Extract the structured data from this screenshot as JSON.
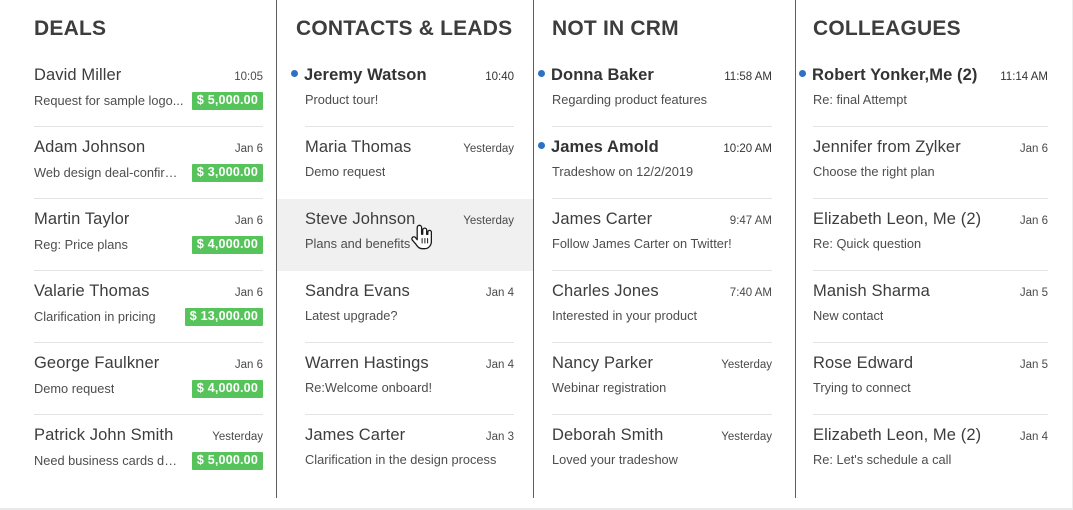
{
  "colors": {
    "accent_green": "#57c45b",
    "unread_dot_blue": "#2f6fc4",
    "divider": "#5d5d5d",
    "row_separator": "#e3e3e3",
    "highlight_bg": "#f0f0f0",
    "text_primary": "#3d3d3d"
  },
  "columns": [
    {
      "title": "DEALS",
      "rows": [
        {
          "name": "David Miller",
          "time": "10:05",
          "snippet": "Request for sample logo...",
          "amount": "$ 5,000.00",
          "unread": false,
          "separator": true,
          "highlight": false
        },
        {
          "name": "Adam Johnson",
          "time": "Jan 6",
          "snippet": "Web design deal-confirm...",
          "amount": "$ 3,000.00",
          "unread": false,
          "separator": true,
          "highlight": false
        },
        {
          "name": "Martin Taylor",
          "time": "Jan 6",
          "snippet": "Reg: Price plans",
          "amount": "$ 4,000.00",
          "unread": false,
          "separator": true,
          "highlight": false
        },
        {
          "name": "Valarie Thomas",
          "time": "Jan 6",
          "snippet": "Clarification in pricing",
          "amount": "$ 13,000.00",
          "unread": false,
          "separator": true,
          "highlight": false
        },
        {
          "name": "George Faulkner",
          "time": "Jan 6",
          "snippet": "Demo request",
          "amount": "$ 4,000.00",
          "unread": false,
          "separator": true,
          "highlight": false
        },
        {
          "name": "Patrick John Smith",
          "time": "Yesterday",
          "snippet": "Need business cards des...",
          "amount": "$ 5,000.00",
          "unread": false,
          "separator": false,
          "highlight": false
        }
      ]
    },
    {
      "title": "CONTACTS & LEADS",
      "rows": [
        {
          "name": "Jeremy Watson",
          "time": "10:40",
          "snippet": "Product tour!",
          "amount": "",
          "unread": true,
          "separator": true,
          "highlight": false
        },
        {
          "name": "Maria Thomas",
          "time": "Yesterday",
          "snippet": "Demo request",
          "amount": "",
          "unread": false,
          "separator": false,
          "highlight": false
        },
        {
          "name": "Steve Johnson",
          "time": "Yesterday",
          "snippet": "Plans and benefits",
          "amount": "",
          "unread": false,
          "separator": false,
          "highlight": true
        },
        {
          "name": "Sandra Evans",
          "time": "Jan 4",
          "snippet": "Latest upgrade?",
          "amount": "",
          "unread": false,
          "separator": true,
          "highlight": false
        },
        {
          "name": "Warren Hastings",
          "time": "Jan 4",
          "snippet": "Re:Welcome onboard!",
          "amount": "",
          "unread": false,
          "separator": true,
          "highlight": false
        },
        {
          "name": "James Carter",
          "time": "Jan 3",
          "snippet": "Clarification in the design process",
          "amount": "",
          "unread": false,
          "separator": false,
          "highlight": false
        }
      ]
    },
    {
      "title": "NOT IN CRM",
      "rows": [
        {
          "name": "Donna Baker",
          "time": "11:58 AM",
          "snippet": "Regarding product features",
          "amount": "",
          "unread": true,
          "separator": true,
          "highlight": false
        },
        {
          "name": "James Amold",
          "time": "10:20 AM",
          "snippet": "Tradeshow on 12/2/2019",
          "amount": "",
          "unread": true,
          "separator": true,
          "highlight": false
        },
        {
          "name": "James Carter",
          "time": "9:47 AM",
          "snippet": "Follow James Carter on Twitter!",
          "amount": "",
          "unread": false,
          "separator": true,
          "highlight": false
        },
        {
          "name": "Charles Jones",
          "time": "7:40 AM",
          "snippet": "Interested in your product",
          "amount": "",
          "unread": false,
          "separator": true,
          "highlight": false
        },
        {
          "name": "Nancy Parker",
          "time": "Yesterday",
          "snippet": "Webinar registration",
          "amount": "",
          "unread": false,
          "separator": true,
          "highlight": false
        },
        {
          "name": "Deborah Smith",
          "time": "Yesterday",
          "snippet": "Loved your tradeshow",
          "amount": "",
          "unread": false,
          "separator": false,
          "highlight": false
        }
      ]
    },
    {
      "title": "COLLEAGUES",
      "rows": [
        {
          "name": "Robert Yonker,Me (2)",
          "time": "11:14 AM",
          "snippet": "Re: final Attempt",
          "amount": "",
          "unread": true,
          "separator": true,
          "highlight": false
        },
        {
          "name": "Jennifer from Zylker",
          "time": "Jan 6",
          "snippet": "Choose the right plan",
          "amount": "",
          "unread": false,
          "separator": true,
          "highlight": false
        },
        {
          "name": "Elizabeth Leon, Me (2)",
          "time": "Jan 6",
          "snippet": "Re: Quick question",
          "amount": "",
          "unread": false,
          "separator": true,
          "highlight": false
        },
        {
          "name": "Manish Sharma",
          "time": "Jan 5",
          "snippet": "New contact",
          "amount": "",
          "unread": false,
          "separator": true,
          "highlight": false
        },
        {
          "name": "Rose Edward",
          "time": "Jan 5",
          "snippet": "Trying to connect",
          "amount": "",
          "unread": false,
          "separator": true,
          "highlight": false
        },
        {
          "name": "Elizabeth Leon, Me (2)",
          "time": "Jan 4",
          "snippet": "Re: Let's schedule a call",
          "amount": "",
          "unread": false,
          "separator": false,
          "highlight": false
        }
      ]
    }
  ],
  "cursor": {
    "icon": "pointing-hand-cursor"
  }
}
